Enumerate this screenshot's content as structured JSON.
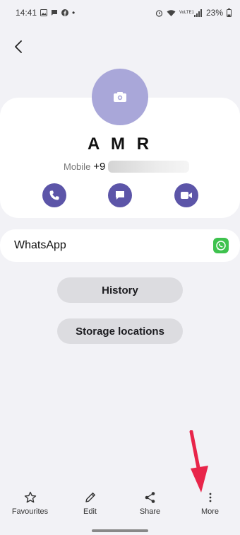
{
  "status": {
    "time": "14:41",
    "dot": "•",
    "network": "VoLTE1",
    "battery": "23%"
  },
  "contact": {
    "name": "A M R",
    "phone_label": "Mobile",
    "phone_visible": "+9"
  },
  "apps": {
    "whatsapp_label": "WhatsApp"
  },
  "buttons": {
    "history": "History",
    "storage": "Storage locations"
  },
  "nav": [
    {
      "label": "Favourites",
      "icon": "star-icon"
    },
    {
      "label": "Edit",
      "icon": "pencil-icon"
    },
    {
      "label": "Share",
      "icon": "share-icon"
    },
    {
      "label": "More",
      "icon": "more-vertical-icon"
    }
  ],
  "colors": {
    "avatar": "#a9a7d9",
    "action": "#5c55a8",
    "whatsapp": "#3ec24e",
    "annotation_arrow": "#e8254a"
  }
}
